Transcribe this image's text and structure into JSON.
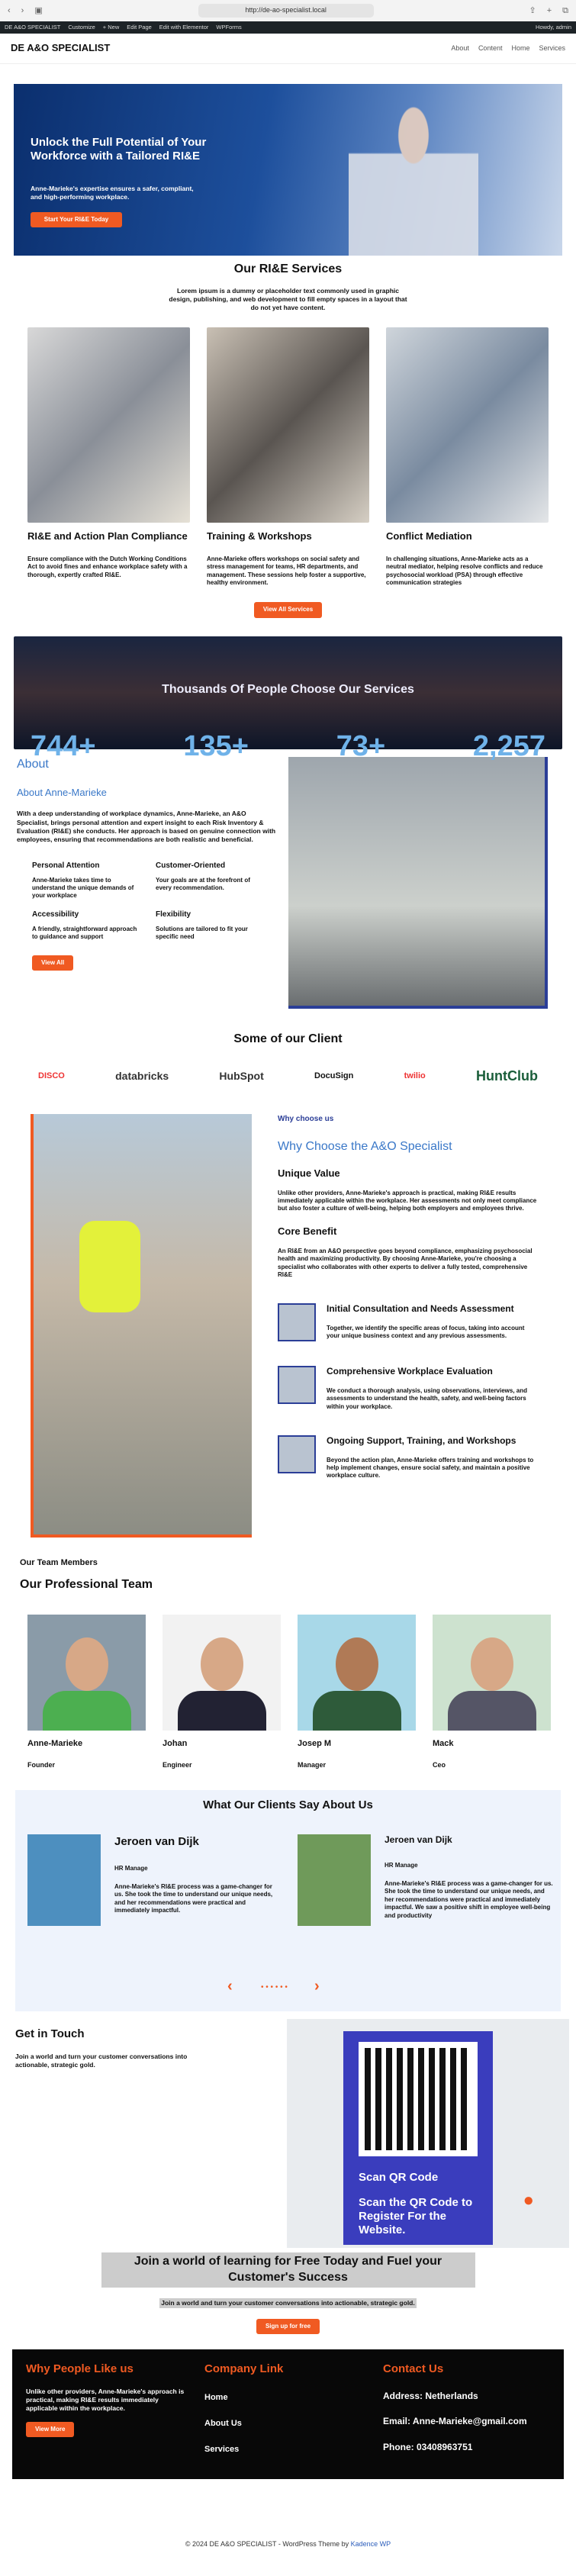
{
  "browser": {
    "url": "http://de-ao-specialist.local"
  },
  "wpbar": {
    "site": "DE A&O SPECIALIST",
    "customize": "Customize",
    "new": "+ New",
    "edit": "Edit Page",
    "elementor": "Edit with Elementor",
    "wpforms": "WPForms",
    "howdy": "Howdy, admin"
  },
  "header": {
    "logo": "DE A&O SPECIALIST",
    "nav": [
      "About",
      "Content",
      "Home",
      "Services"
    ]
  },
  "hero": {
    "title": "Unlock the Full Potential of Your Workforce with a Tailored RI&E",
    "sub": "Anne-Marieke's expertise ensures a safer, compliant, and high-performing workplace.",
    "button": "Start Your RI&E Today"
  },
  "services": {
    "title": "Our RI&E Services",
    "lead": "Lorem ipsum is a dummy or placeholder text commonly used in graphic design, publishing, and web development to fill empty spaces in a layout that do not yet have content.",
    "items": [
      {
        "title": "RI&E and Action Plan Compliance",
        "text": "Ensure compliance with the Dutch Working Conditions Act to avoid fines and enhance workplace safety with a thorough, expertly crafted RI&E."
      },
      {
        "title": "Training & Workshops",
        "text": "Anne-Marieke offers workshops on social safety and stress management for teams, HR departments, and management. These sessions help foster a supportive, healthy environment."
      },
      {
        "title": "Conflict Mediation",
        "text": "In challenging situations, Anne-Marieke acts as a neutral mediator, helping resolve conflicts and reduce psychosocial workload (PSA) through effective communication strategies"
      }
    ],
    "button": "View All Services"
  },
  "stats": {
    "title": "Thousands Of People Choose Our Services",
    "values": [
      "744+",
      "135+",
      "73+",
      "2,257"
    ]
  },
  "about": {
    "title": "About",
    "sub": "About Anne-Marieke",
    "desc": "With a deep understanding of workplace dynamics, Anne-Marieke, an A&O Specialist, brings personal attention and expert insight to each Risk Inventory & Evaluation (RI&E) she conducts. Her approach is based on genuine connection with employees, ensuring that recommendations are both realistic and beneficial.",
    "features": [
      {
        "t": "Personal Attention",
        "d": "Anne-Marieke takes time to understand the unique demands of your workplace"
      },
      {
        "t": "Customer-Oriented",
        "d": "Your goals are at the forefront of every recommendation."
      },
      {
        "t": "Accessibility",
        "d": "A friendly, straightforward approach to guidance and support"
      },
      {
        "t": "Flexibility",
        "d": "Solutions are tailored to fit your specific need"
      }
    ],
    "button": "View All"
  },
  "clients": {
    "title": "Some of our Client",
    "logos": [
      "DISCO",
      "databricks",
      "HubSpot",
      "DocuSign",
      "twilio",
      "HuntClub"
    ]
  },
  "why": {
    "small": "Why choose us",
    "title": "Why Choose the A&O Specialist",
    "uv": "Unique Value",
    "uv_text": "Unlike other providers, Anne-Marieke's approach is practical, making RI&E results immediately applicable within the workplace. Her assessments not only meet compliance but also foster a culture of well-being, helping both employers and employees thrive.",
    "cb": "Core Benefit",
    "cb_text": "An RI&E from an A&O perspective goes beyond compliance, emphasizing psychosocial health and maximizing productivity. By choosing Anne-Marieke, you're choosing a specialist who collaborates with other experts to deliver a fully tested, comprehensive RI&E",
    "steps": [
      {
        "t": "Initial Consultation and Needs Assessment",
        "d": "Together, we identify the specific areas of focus, taking into account your unique business context and any previous assessments."
      },
      {
        "t": "Comprehensive Workplace Evaluation",
        "d": "We conduct a thorough analysis, using observations, interviews, and assessments to understand the health, safety, and well-being factors within your workplace."
      },
      {
        "t": "Ongoing Support, Training, and Workshops",
        "d": "Beyond the action plan, Anne-Marieke offers training and workshops to help implement changes, ensure social safety, and maintain a positive workplace culture."
      }
    ]
  },
  "team": {
    "head": "Our Team Members",
    "title": "Our Professional Team",
    "members": [
      {
        "n": "Anne-Marieke",
        "r": "Founder"
      },
      {
        "n": "Johan",
        "r": "Engineer"
      },
      {
        "n": "Josep M",
        "r": "Manager"
      },
      {
        "n": "Mack",
        "r": "Ceo"
      }
    ]
  },
  "testimonials": {
    "title": "What Our Clients Say About Us",
    "items": [
      {
        "n": "Jeroen van Dijk",
        "r": "HR Manage",
        "t": "Anne-Marieke's RI&E process was a game-changer for us. She took the time to understand our unique needs, and her recommendations were practical and immediately impactful."
      },
      {
        "n": "Jeroen van Dijk",
        "r": "HR Manage",
        "t": "Anne-Marieke's RI&E process was a game-changer for us. She took the time to understand our unique needs, and her recommendations were practical and immediately impactful. We saw a positive shift in employee well-being and productivity"
      }
    ]
  },
  "contact": {
    "title": "Get in Touch",
    "text": "Join a world and turn your customer conversations into actionable, strategic gold.",
    "qr_a": "Scan QR Code",
    "qr_b": "Scan the QR Code to Register For the Website."
  },
  "cta": {
    "title": "Join a world of learning for Free Today and Fuel your Customer's Success",
    "sub": "Join a world and turn your customer conversations into actionable, strategic gold.",
    "button": "Sign up for free"
  },
  "footer": {
    "c1t": "Why People Like us",
    "c1p": "Unlike other providers, Anne-Marieke's approach is practical, making RI&E results immediately applicable within the workplace.",
    "c1b": "View More",
    "c2t": "Company Link",
    "links": [
      "Home",
      "About Us",
      "Services"
    ],
    "c3t": "Contact Us",
    "addr": "Address: Netherlands",
    "email": "Email: Anne-Marieke@gmail.com",
    "phone": "Phone: 03408963751"
  },
  "copy": {
    "text": "© 2024 DE A&O SPECIALIST - WordPress Theme by",
    "link": "Kadence WP"
  }
}
